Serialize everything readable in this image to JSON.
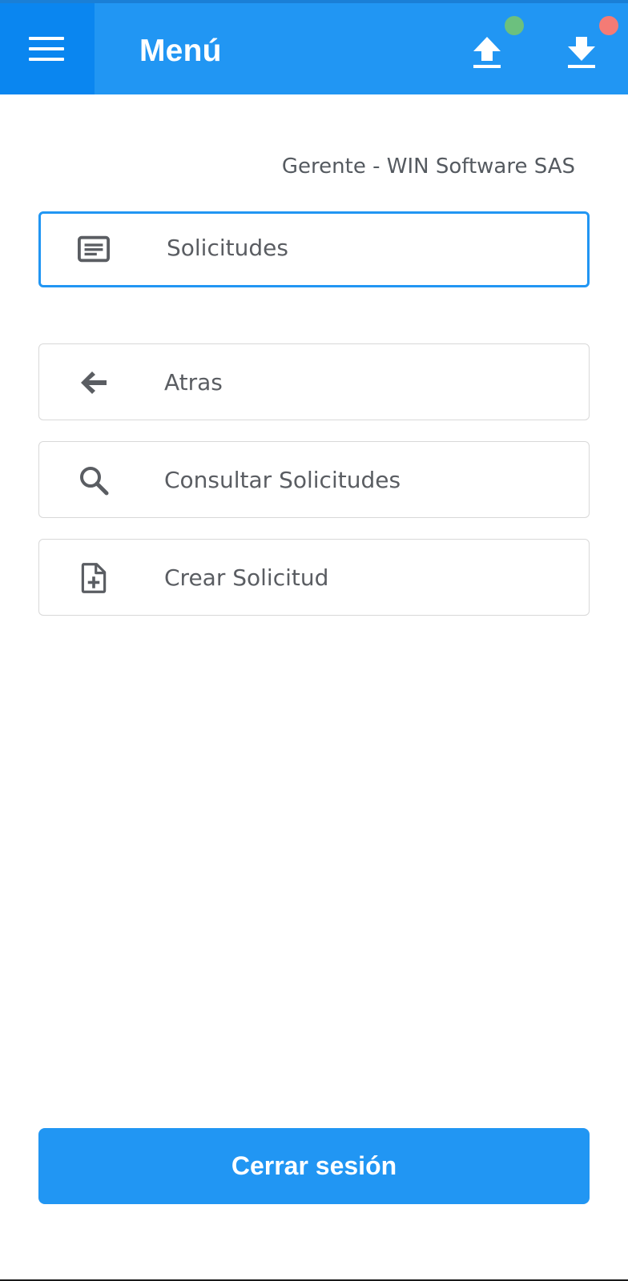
{
  "appbar": {
    "title": "Menú",
    "menu_icon": "hamburger-menu-icon",
    "upload_icon": "upload-icon",
    "download_icon": "download-icon",
    "upload_status_color": "#6cc07e",
    "download_status_color": "#f47b75",
    "background_color": "#2196f3",
    "menu_button_color": "#0a86f0"
  },
  "user": {
    "role_label": "Gerente - WIN Software SAS"
  },
  "menu": {
    "section": {
      "label": "Solicitudes",
      "icon": "notes-icon",
      "active": true
    },
    "items": [
      {
        "label": "Atras",
        "icon": "arrow-left-icon"
      },
      {
        "label": "Consultar Solicitudes",
        "icon": "search-icon"
      },
      {
        "label": "Crear Solicitud",
        "icon": "file-add-icon"
      }
    ]
  },
  "footer": {
    "logout_label": "Cerrar sesión"
  }
}
